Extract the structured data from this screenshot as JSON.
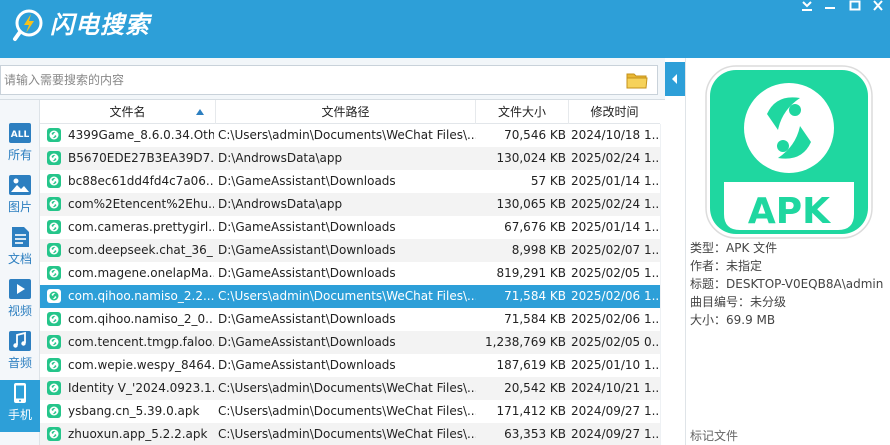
{
  "app": {
    "title": "闪电搜索"
  },
  "colors": {
    "accent": "#2d9fd8",
    "apk_green": "#1fd7a0",
    "file_icon_green": "#25c58a"
  },
  "search": {
    "placeholder": "请输入需要搜索的内容",
    "value": ""
  },
  "sidebar": {
    "items": [
      {
        "label": "所有",
        "icon": "all-icon"
      },
      {
        "label": "图片",
        "icon": "image-icon"
      },
      {
        "label": "文档",
        "icon": "document-icon"
      },
      {
        "label": "视频",
        "icon": "video-icon"
      },
      {
        "label": "音频",
        "icon": "audio-icon"
      },
      {
        "label": "手机",
        "icon": "phone-icon",
        "active": true
      }
    ]
  },
  "table": {
    "columns": [
      "文件名",
      "文件路径",
      "文件大小",
      "修改时间"
    ],
    "sort": {
      "column": "文件名",
      "direction": "ascending"
    },
    "rows": [
      {
        "name": "4399Game_8.6.0.34.Oth...",
        "path": "C:\\Users\\admin\\Documents\\WeChat Files\\...",
        "size": "70,546 KB",
        "time": "2024/10/18 1..."
      },
      {
        "name": "B5670EDE27B3EA39D7...",
        "path": "D:\\AndrowsData\\app",
        "size": "130,024 KB",
        "time": "2025/02/24 1..."
      },
      {
        "name": "bc88ec61dd4fd4c7a06...",
        "path": "D:\\GameAssistant\\Downloads",
        "size": "57 KB",
        "time": "2025/01/14 1..."
      },
      {
        "name": "com%2Etencent%2Ehu...",
        "path": "D:\\AndrowsData\\app",
        "size": "130,065 KB",
        "time": "2025/02/24 1..."
      },
      {
        "name": "com.cameras.prettygirl...",
        "path": "D:\\GameAssistant\\Downloads",
        "size": "67,676 KB",
        "time": "2025/01/14 1..."
      },
      {
        "name": "com.deepseek.chat_36_...",
        "path": "D:\\GameAssistant\\Downloads",
        "size": "8,998 KB",
        "time": "2025/02/07 1..."
      },
      {
        "name": "com.magene.onelapMa...",
        "path": "D:\\GameAssistant\\Downloads",
        "size": "819,291 KB",
        "time": "2025/02/05 1..."
      },
      {
        "name": "com.qihoo.namiso_2.2....",
        "path": "C:\\Users\\admin\\Documents\\WeChat Files\\...",
        "size": "71,584 KB",
        "time": "2025/02/06 1...",
        "selected": true
      },
      {
        "name": "com.qihoo.namiso_2_0....",
        "path": "D:\\GameAssistant\\Downloads",
        "size": "71,584 KB",
        "time": "2025/02/06 1..."
      },
      {
        "name": "com.tencent.tmgp.faloo...",
        "path": "D:\\GameAssistant\\Downloads",
        "size": "1,238,769 KB",
        "time": "2025/02/05 0..."
      },
      {
        "name": "com.wepie.wespy_8464...",
        "path": "D:\\GameAssistant\\Downloads",
        "size": "187,619 KB",
        "time": "2025/01/10 1..."
      },
      {
        "name": "Identity V_'2024.0923.1...",
        "path": "C:\\Users\\admin\\Documents\\WeChat Files\\...",
        "size": "20,542 KB",
        "time": "2024/10/21 1..."
      },
      {
        "name": "ysbang.cn_5.39.0.apk",
        "path": "C:\\Users\\admin\\Documents\\WeChat Files\\...",
        "size": "171,412 KB",
        "time": "2024/09/27 1..."
      },
      {
        "name": "zhuoxun.app_5.2.2.apk",
        "path": "C:\\Users\\admin\\Documents\\WeChat Files\\...",
        "size": "63,353 KB",
        "time": "2024/09/27 1..."
      }
    ]
  },
  "preview": {
    "badge_text": "APK",
    "details": [
      "类型：APK 文件",
      "作者：未指定",
      "标题：DESKTOP-V0EQB8A\\admin",
      "曲目编号：未分级",
      "大小：69.9 MB"
    ],
    "mark_file": "标记文件"
  }
}
